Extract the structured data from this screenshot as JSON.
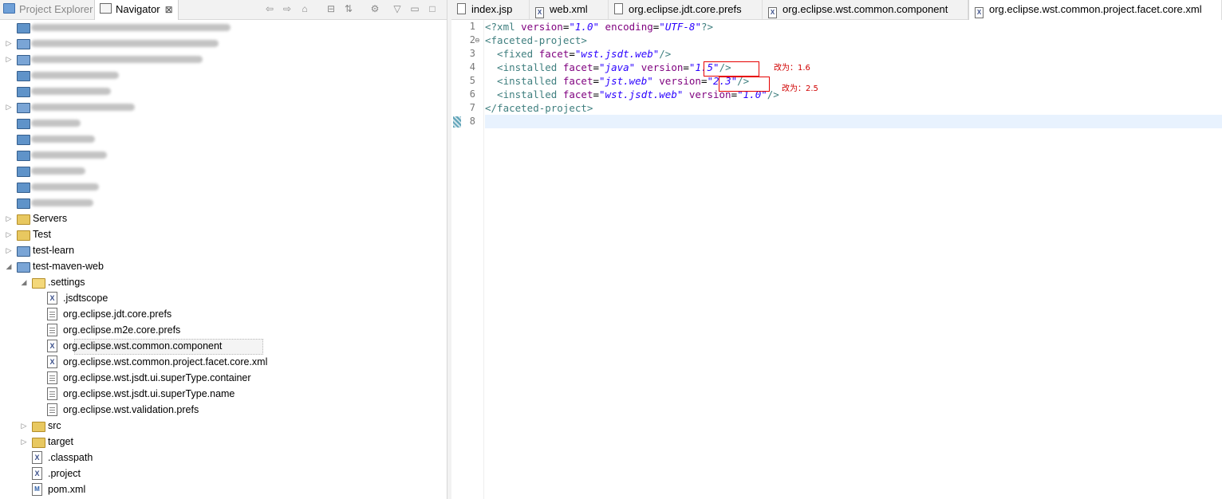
{
  "left_panel": {
    "tabs": [
      {
        "label": "Project Explorer"
      },
      {
        "label": "Navigator",
        "close": "⊠"
      }
    ],
    "toolbar_icons": [
      "back-icon",
      "forward-icon",
      "home-icon",
      "collapse-all-icon",
      "link-editor-icon",
      "filter-icon",
      "view-menu-icon",
      "minimize-icon",
      "maximize-icon"
    ],
    "tree": [
      {
        "label": "",
        "indent": 0,
        "icon": "project",
        "twisty": "",
        "blur": true
      },
      {
        "label": "",
        "indent": 0,
        "icon": "project-m",
        "twisty": "▷",
        "blur": true
      },
      {
        "label": "",
        "indent": 0,
        "icon": "project-m",
        "twisty": "▷",
        "blur": true
      },
      {
        "label": "",
        "indent": 0,
        "icon": "project",
        "twisty": "",
        "blur": true
      },
      {
        "label": "",
        "indent": 0,
        "icon": "project",
        "twisty": "",
        "blur": true
      },
      {
        "label": "",
        "indent": 0,
        "icon": "project-m",
        "twisty": "▷",
        "blur": true
      },
      {
        "label": "",
        "indent": 0,
        "icon": "project",
        "twisty": "",
        "blur": true
      },
      {
        "label": "",
        "indent": 0,
        "icon": "project",
        "twisty": "",
        "blur": true
      },
      {
        "label": "",
        "indent": 0,
        "icon": "project",
        "twisty": "",
        "blur": true
      },
      {
        "label": "",
        "indent": 0,
        "icon": "project",
        "twisty": "",
        "blur": true
      },
      {
        "label": "",
        "indent": 0,
        "icon": "project",
        "twisty": "",
        "blur": true
      },
      {
        "label": "",
        "indent": 0,
        "icon": "project",
        "twisty": "",
        "blur": true
      },
      {
        "label": "Servers",
        "indent": 0,
        "icon": "folder",
        "twisty": "▷"
      },
      {
        "label": "Test",
        "indent": 0,
        "icon": "folder",
        "twisty": "▷"
      },
      {
        "label": "test-learn",
        "indent": 0,
        "icon": "project-m",
        "twisty": "▷"
      },
      {
        "label": "test-maven-web",
        "indent": 0,
        "icon": "project-m",
        "twisty": "◢"
      },
      {
        "label": ".settings",
        "indent": 1,
        "icon": "folder-open",
        "twisty": "◢"
      },
      {
        "label": ".jsdtscope",
        "indent": 2,
        "icon": "xml",
        "twisty": ""
      },
      {
        "label": "org.eclipse.jdt.core.prefs",
        "indent": 2,
        "icon": "file",
        "twisty": ""
      },
      {
        "label": "org.eclipse.m2e.core.prefs",
        "indent": 2,
        "icon": "file",
        "twisty": ""
      },
      {
        "label": "org.eclipse.wst.common.component",
        "indent": 2,
        "icon": "xml",
        "twisty": "",
        "selected": true
      },
      {
        "label": "org.eclipse.wst.common.project.facet.core.xml",
        "indent": 2,
        "icon": "xml",
        "twisty": ""
      },
      {
        "label": "org.eclipse.wst.jsdt.ui.superType.container",
        "indent": 2,
        "icon": "file",
        "twisty": ""
      },
      {
        "label": "org.eclipse.wst.jsdt.ui.superType.name",
        "indent": 2,
        "icon": "file",
        "twisty": ""
      },
      {
        "label": "org.eclipse.wst.validation.prefs",
        "indent": 2,
        "icon": "file",
        "twisty": ""
      },
      {
        "label": "src",
        "indent": 1,
        "icon": "folder",
        "twisty": "▷"
      },
      {
        "label": "target",
        "indent": 1,
        "icon": "folder",
        "twisty": "▷"
      },
      {
        "label": ".classpath",
        "indent": 1,
        "icon": "xml",
        "twisty": ""
      },
      {
        "label": ".project",
        "indent": 1,
        "icon": "xml",
        "twisty": ""
      },
      {
        "label": "pom.xml",
        "indent": 1,
        "icon": "pom",
        "twisty": ""
      }
    ]
  },
  "editor": {
    "tabs": [
      {
        "label": "index.jsp",
        "icon": "file"
      },
      {
        "label": "web.xml",
        "icon": "xml"
      },
      {
        "label": "org.eclipse.jdt.core.prefs",
        "icon": "file"
      },
      {
        "label": "org.eclipse.wst.common.component",
        "icon": "xml"
      },
      {
        "label": "org.eclipse.wst.common.project.facet.core.xml",
        "icon": "xml",
        "active": true
      }
    ],
    "line_numbers": [
      "1",
      "2",
      "3",
      "4",
      "5",
      "6",
      "7",
      "8"
    ],
    "lines": [
      [
        {
          "t": "<?xml ",
          "c": "tag"
        },
        {
          "t": "version",
          "c": "attr"
        },
        {
          "t": "=",
          "c": "plain"
        },
        {
          "t": "\"1.0\"",
          "c": "val"
        },
        {
          "t": " ",
          "c": "plain"
        },
        {
          "t": "encoding",
          "c": "attr"
        },
        {
          "t": "=",
          "c": "plain"
        },
        {
          "t": "\"UTF-8\"",
          "c": "val"
        },
        {
          "t": "?>",
          "c": "tag"
        }
      ],
      [
        {
          "t": "<faceted-project>",
          "c": "tag"
        }
      ],
      [
        {
          "t": "  <fixed ",
          "c": "tag"
        },
        {
          "t": "facet",
          "c": "attr"
        },
        {
          "t": "=",
          "c": "plain"
        },
        {
          "t": "\"wst.jsdt.web\"",
          "c": "val"
        },
        {
          "t": "/>",
          "c": "tag"
        }
      ],
      [
        {
          "t": "  <installed ",
          "c": "tag"
        },
        {
          "t": "facet",
          "c": "attr"
        },
        {
          "t": "=",
          "c": "plain"
        },
        {
          "t": "\"java\"",
          "c": "val"
        },
        {
          "t": " ",
          "c": "plain"
        },
        {
          "t": "version",
          "c": "attr"
        },
        {
          "t": "=",
          "c": "plain"
        },
        {
          "t": "\"1.5\"",
          "c": "val"
        },
        {
          "t": "/>",
          "c": "tag"
        }
      ],
      [
        {
          "t": "  <installed ",
          "c": "tag"
        },
        {
          "t": "facet",
          "c": "attr"
        },
        {
          "t": "=",
          "c": "plain"
        },
        {
          "t": "\"jst.web\"",
          "c": "val"
        },
        {
          "t": " ",
          "c": "plain"
        },
        {
          "t": "version",
          "c": "attr"
        },
        {
          "t": "=",
          "c": "plain"
        },
        {
          "t": "\"2.3\"",
          "c": "val"
        },
        {
          "t": "/>",
          "c": "tag"
        }
      ],
      [
        {
          "t": "  <installed ",
          "c": "tag"
        },
        {
          "t": "facet",
          "c": "attr"
        },
        {
          "t": "=",
          "c": "plain"
        },
        {
          "t": "\"wst.jsdt.web\"",
          "c": "val"
        },
        {
          "t": " ",
          "c": "plain"
        },
        {
          "t": "version",
          "c": "attr"
        },
        {
          "t": "=",
          "c": "plain"
        },
        {
          "t": "\"1.0\"",
          "c": "val"
        },
        {
          "t": "/>",
          "c": "tag"
        }
      ],
      [
        {
          "t": "</faceted-project>",
          "c": "tag"
        }
      ],
      []
    ],
    "annotations": [
      {
        "text": "改为：1.6"
      },
      {
        "text": "改为：2.5"
      }
    ]
  },
  "colors": {
    "tag": "#3f7f7f",
    "attr": "#7f007f",
    "value": "#2a00ff",
    "annotation": "#e60000",
    "current_line": "#e8f2fe"
  }
}
